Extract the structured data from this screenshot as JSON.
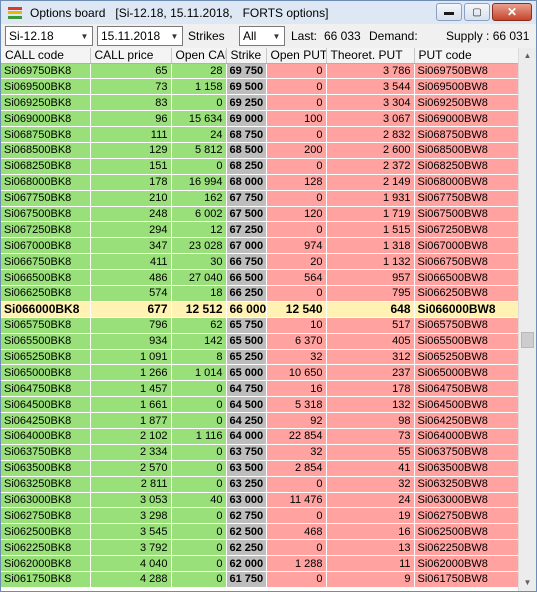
{
  "window": {
    "title": "Options board",
    "context": "[Si-12.18, 15.11.2018,   FORTS options]",
    "colors": {
      "call": "#99e07a",
      "put": "#ffa2a0",
      "strike": "#bdbdbd",
      "atm": "#fff2b2"
    }
  },
  "toolbar": {
    "instrument": "Si-12.18",
    "expiry": "15.11.2018",
    "strikes_label": "Strikes",
    "strikes_value": "All",
    "last_label": "Last:",
    "last_value": "66 033",
    "demand_label": "Demand:",
    "supply_label": "Supply : 66 031"
  },
  "columns": [
    "CALL code",
    "CALL price",
    "Open CAL",
    "Strike",
    "Open PUT",
    "Theoret. PUT",
    "PUT code"
  ],
  "rows": [
    [
      "Si069750BK8",
      "65",
      "28",
      "69 750",
      "0",
      "3 786",
      "Si069750BW8"
    ],
    [
      "Si069500BK8",
      "73",
      "1 158",
      "69 500",
      "0",
      "3 544",
      "Si069500BW8"
    ],
    [
      "Si069250BK8",
      "83",
      "0",
      "69 250",
      "0",
      "3 304",
      "Si069250BW8"
    ],
    [
      "Si069000BK8",
      "96",
      "15 634",
      "69 000",
      "100",
      "3 067",
      "Si069000BW8"
    ],
    [
      "Si068750BK8",
      "111",
      "24",
      "68 750",
      "0",
      "2 832",
      "Si068750BW8"
    ],
    [
      "Si068500BK8",
      "129",
      "5 812",
      "68 500",
      "200",
      "2 600",
      "Si068500BW8"
    ],
    [
      "Si068250BK8",
      "151",
      "0",
      "68 250",
      "0",
      "2 372",
      "Si068250BW8"
    ],
    [
      "Si068000BK8",
      "178",
      "16 994",
      "68 000",
      "128",
      "2 149",
      "Si068000BW8"
    ],
    [
      "Si067750BK8",
      "210",
      "162",
      "67 750",
      "0",
      "1 931",
      "Si067750BW8"
    ],
    [
      "Si067500BK8",
      "248",
      "6 002",
      "67 500",
      "120",
      "1 719",
      "Si067500BW8"
    ],
    [
      "Si067250BK8",
      "294",
      "12",
      "67 250",
      "0",
      "1 515",
      "Si067250BW8"
    ],
    [
      "Si067000BK8",
      "347",
      "23 028",
      "67 000",
      "974",
      "1 318",
      "Si067000BW8"
    ],
    [
      "Si066750BK8",
      "411",
      "30",
      "66 750",
      "20",
      "1 132",
      "Si066750BW8"
    ],
    [
      "Si066500BK8",
      "486",
      "27 040",
      "66 500",
      "564",
      "957",
      "Si066500BW8"
    ],
    [
      "Si066250BK8",
      "574",
      "18",
      "66 250",
      "0",
      "795",
      "Si066250BW8"
    ],
    [
      "Si066000BK8",
      "677",
      "12 512",
      "66 000",
      "12 540",
      "648",
      "Si066000BW8"
    ],
    [
      "Si065750BK8",
      "796",
      "62",
      "65 750",
      "10",
      "517",
      "Si065750BW8"
    ],
    [
      "Si065500BK8",
      "934",
      "142",
      "65 500",
      "6 370",
      "405",
      "Si065500BW8"
    ],
    [
      "Si065250BK8",
      "1 091",
      "8",
      "65 250",
      "32",
      "312",
      "Si065250BW8"
    ],
    [
      "Si065000BK8",
      "1 266",
      "1 014",
      "65 000",
      "10 650",
      "237",
      "Si065000BW8"
    ],
    [
      "Si064750BK8",
      "1 457",
      "0",
      "64 750",
      "16",
      "178",
      "Si064750BW8"
    ],
    [
      "Si064500BK8",
      "1 661",
      "0",
      "64 500",
      "5 318",
      "132",
      "Si064500BW8"
    ],
    [
      "Si064250BK8",
      "1 877",
      "0",
      "64 250",
      "92",
      "98",
      "Si064250BW8"
    ],
    [
      "Si064000BK8",
      "2 102",
      "1 116",
      "64 000",
      "22 854",
      "73",
      "Si064000BW8"
    ],
    [
      "Si063750BK8",
      "2 334",
      "0",
      "63 750",
      "32",
      "55",
      "Si063750BW8"
    ],
    [
      "Si063500BK8",
      "2 570",
      "0",
      "63 500",
      "2 854",
      "41",
      "Si063500BW8"
    ],
    [
      "Si063250BK8",
      "2 811",
      "0",
      "63 250",
      "0",
      "32",
      "Si063250BW8"
    ],
    [
      "Si063000BK8",
      "3 053",
      "40",
      "63 000",
      "11 476",
      "24",
      "Si063000BW8"
    ],
    [
      "Si062750BK8",
      "3 298",
      "0",
      "62 750",
      "0",
      "19",
      "Si062750BW8"
    ],
    [
      "Si062500BK8",
      "3 545",
      "0",
      "62 500",
      "468",
      "16",
      "Si062500BW8"
    ],
    [
      "Si062250BK8",
      "3 792",
      "0",
      "62 250",
      "0",
      "13",
      "Si062250BW8"
    ],
    [
      "Si062000BK8",
      "4 040",
      "0",
      "62 000",
      "1 288",
      "11",
      "Si062000BW8"
    ],
    [
      "Si061750BK8",
      "4 288",
      "0",
      "61 750",
      "0",
      "9",
      "Si061750BW8"
    ]
  ],
  "atm_strike": "66 000"
}
